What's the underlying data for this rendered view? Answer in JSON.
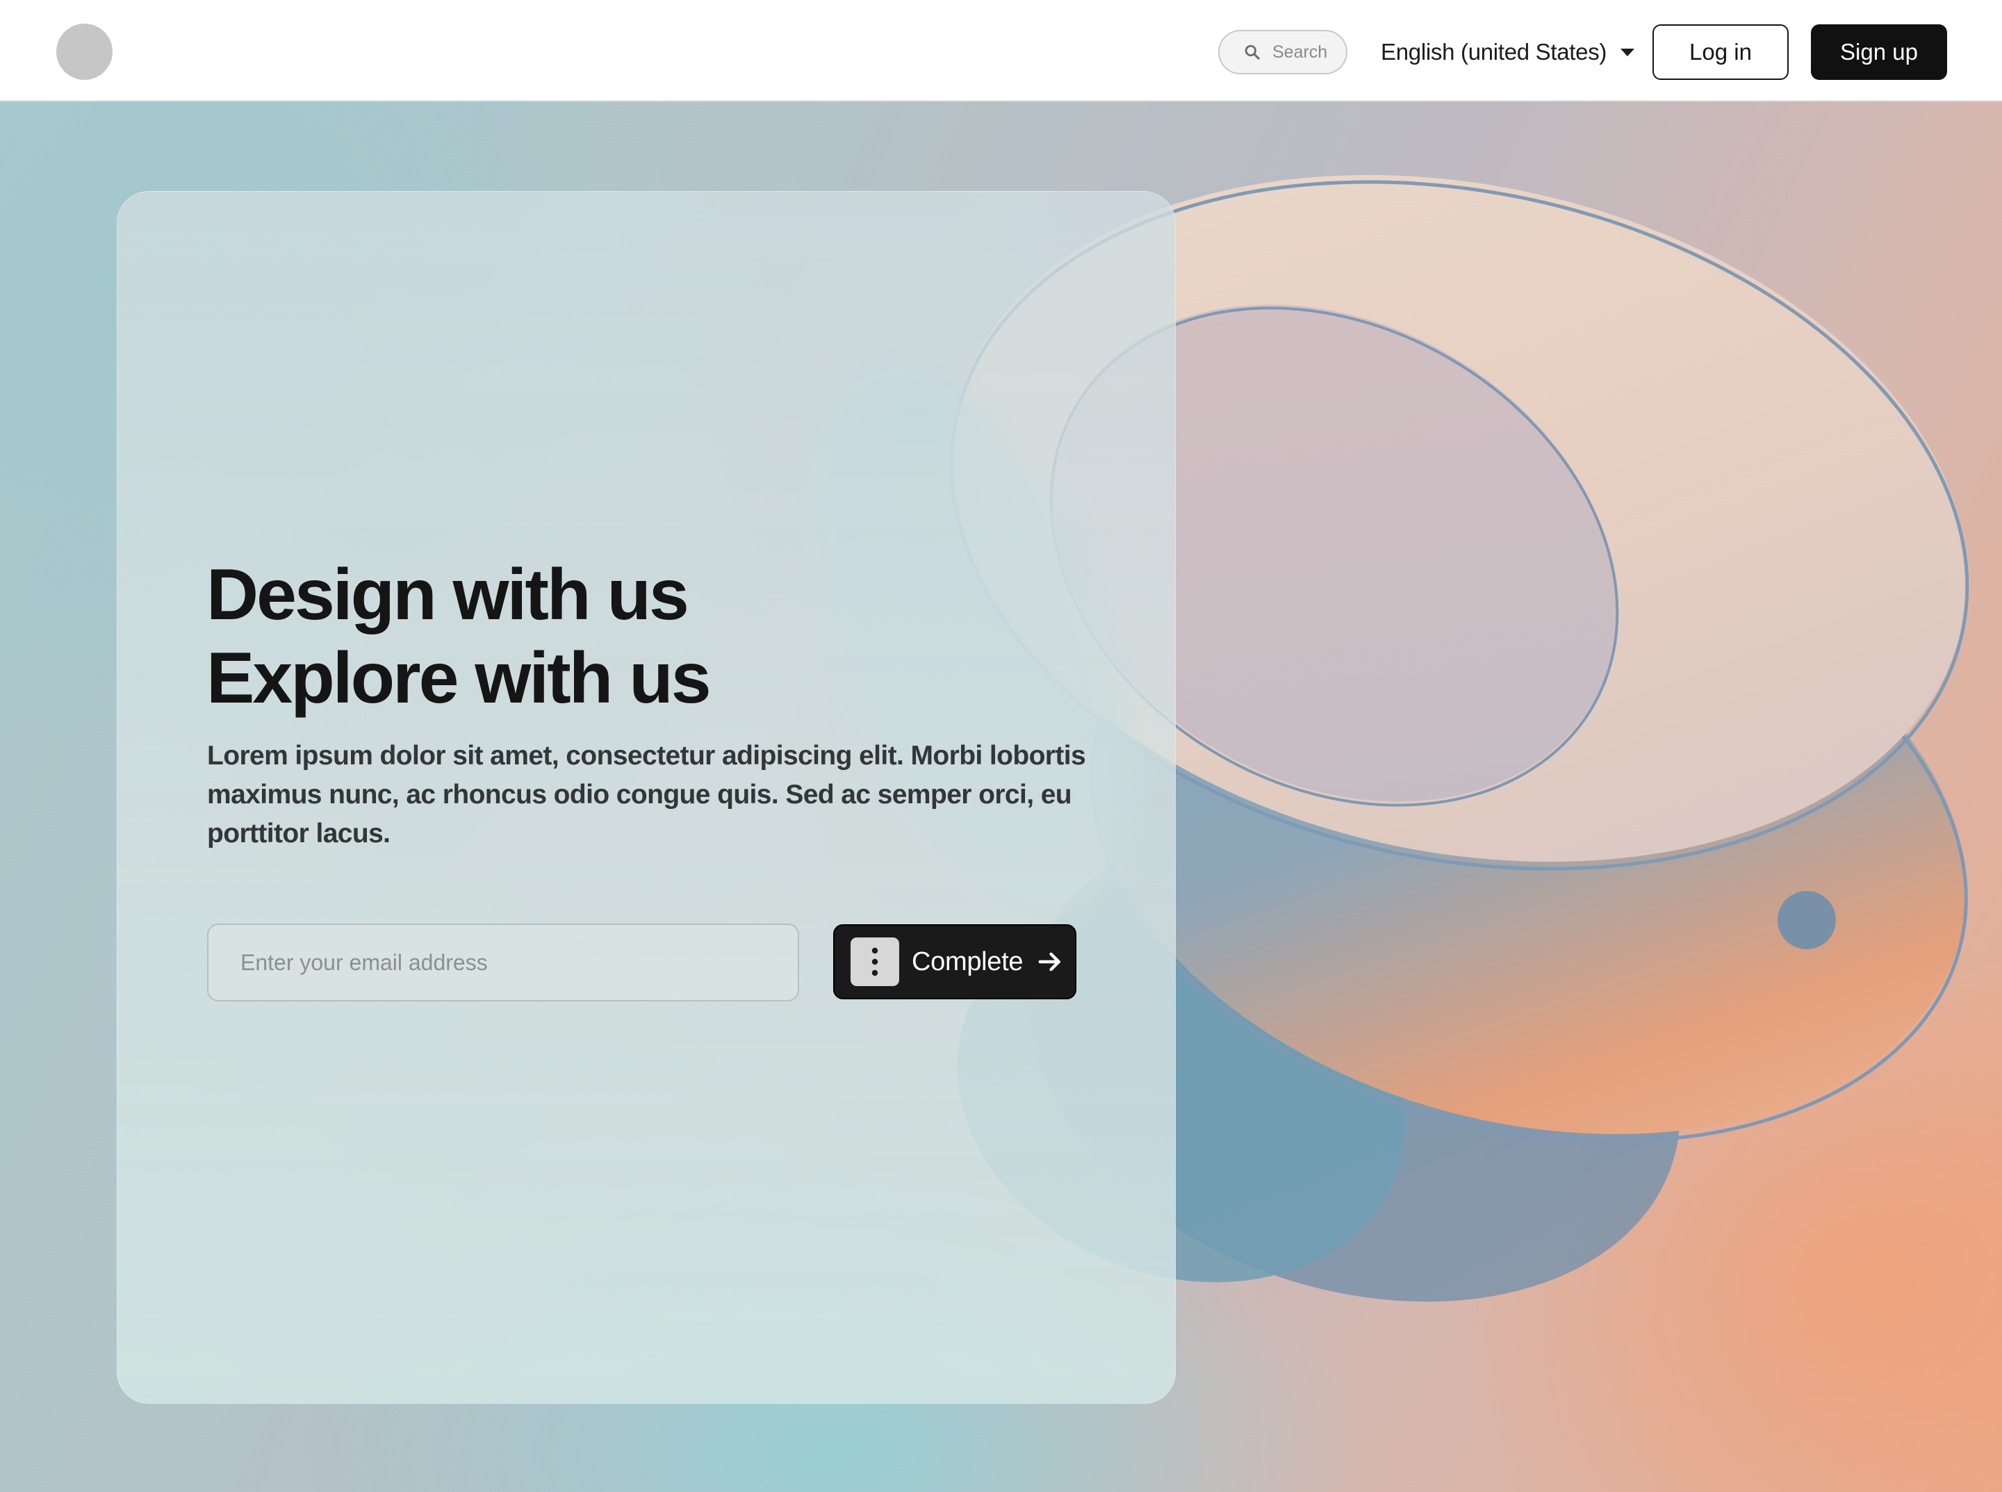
{
  "header": {
    "search_placeholder": "Search",
    "language": "English (united States)",
    "login_label": "Log in",
    "signup_label": "Sign up"
  },
  "hero": {
    "headline_line1": "Design with us",
    "headline_line2": "Explore with us",
    "description": "Lorem ipsum dolor sit amet, consectetur adipiscing elit. Morbi lobortis maximus nunc, ac rhoncus odio congue quis. Sed ac semper orci, eu porttitor lacus.",
    "email_placeholder": "Enter your email address",
    "complete_label": "Complete"
  },
  "icons": {
    "search": "search-icon",
    "language_caret": "caret-down-icon",
    "drag_handle": "more-vertical-icon",
    "arrow": "arrow-right-icon"
  },
  "colors": {
    "primary": "#111111",
    "background": "#ffffff",
    "logo_placeholder": "#c6c6c6"
  }
}
